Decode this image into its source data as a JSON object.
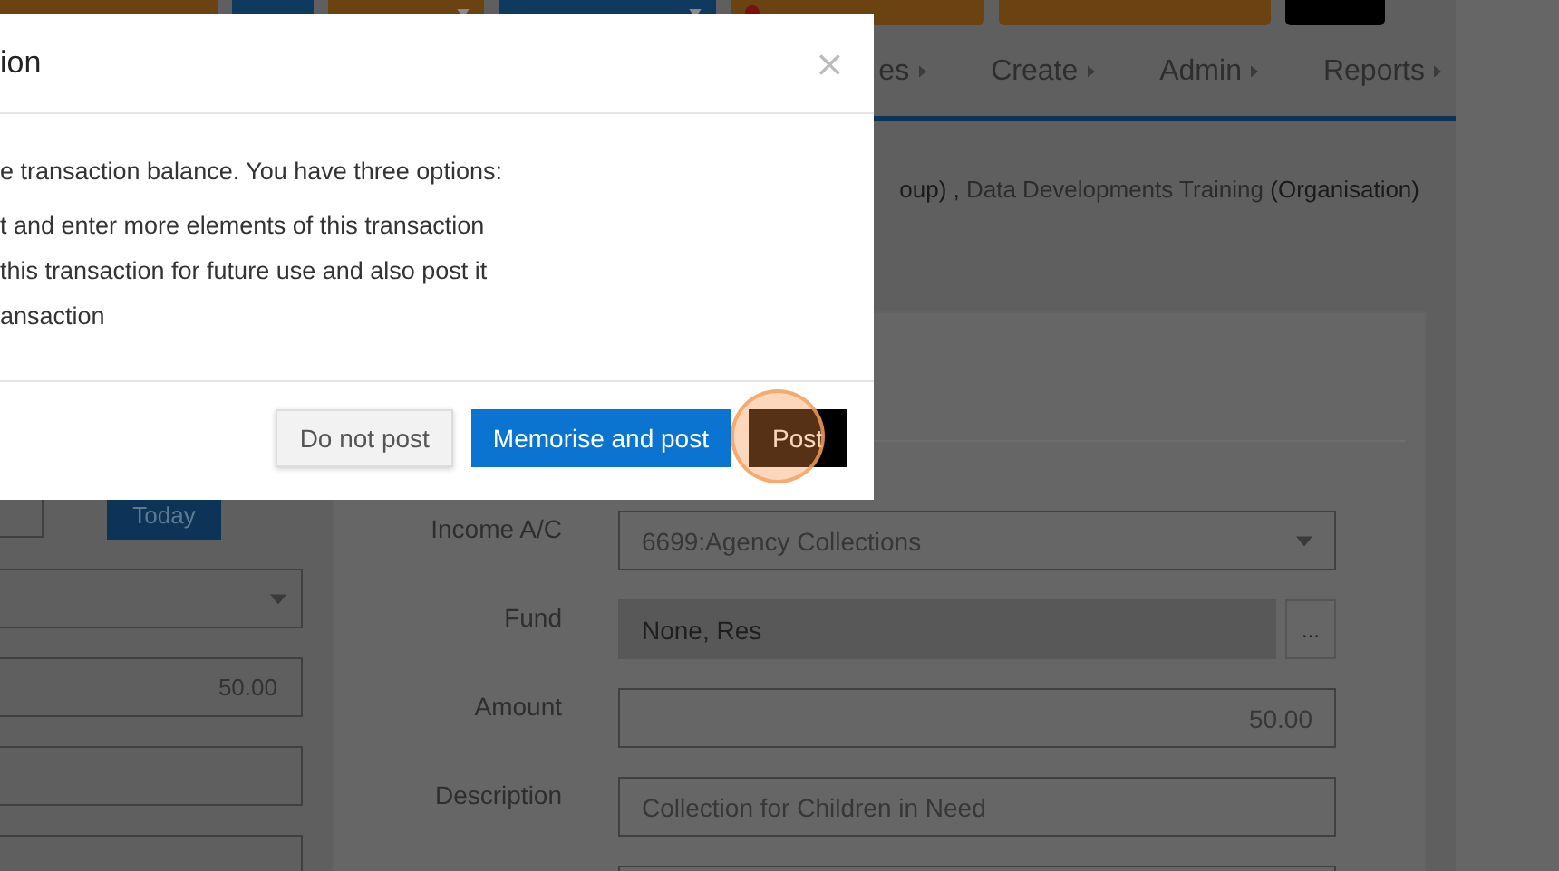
{
  "top_bar": [
    {
      "color": "#6b4312",
      "caret": false,
      "dot": false
    },
    {
      "color": "#0f3a5e",
      "caret": false,
      "dot": false
    },
    {
      "color": "#6b4312",
      "caret": true,
      "dot": false
    },
    {
      "color": "#0f3a5e",
      "caret": true,
      "dot": false
    },
    {
      "color": "#6b4312",
      "caret": false,
      "dot": true
    },
    {
      "color": "#6b4312",
      "caret": false,
      "dot": false
    },
    {
      "color": "#000000",
      "caret": false,
      "dot": false
    }
  ],
  "nav": [
    {
      "label": "es"
    },
    {
      "label": "Create"
    },
    {
      "label": "Admin"
    },
    {
      "label": "Reports"
    }
  ],
  "breadcrumb": {
    "tail": "oup) ,",
    "link": "Data Developments Training",
    "type": "(Organisation)"
  },
  "left_column": {
    "today_button": "Today",
    "fields": [
      {
        "kind": "select"
      },
      {
        "kind": "number",
        "value": "50.00"
      },
      {
        "kind": "text"
      }
    ]
  },
  "form": [
    {
      "label": "Income A/C",
      "kind": "select",
      "value": "6699:Agency Collections"
    },
    {
      "label": "Fund",
      "kind": "lookup",
      "value": "None, Res",
      "button": "..."
    },
    {
      "label": "Amount",
      "kind": "number",
      "value": "50.00"
    },
    {
      "label": "Description",
      "kind": "text",
      "value": "Collection for Children in Need"
    }
  ],
  "dialog": {
    "title": "ion",
    "close": "×",
    "intro": "e transaction balance. You have three options:",
    "options": [
      "t and enter more elements of this transaction",
      "this transaction for future use and also post it",
      "ansaction"
    ],
    "buttons": [
      {
        "label": "Do not post",
        "kind": "default"
      },
      {
        "label": "Memorise and post",
        "kind": "primary"
      },
      {
        "label": "Post",
        "kind": "dark",
        "highlighted": true
      }
    ]
  }
}
